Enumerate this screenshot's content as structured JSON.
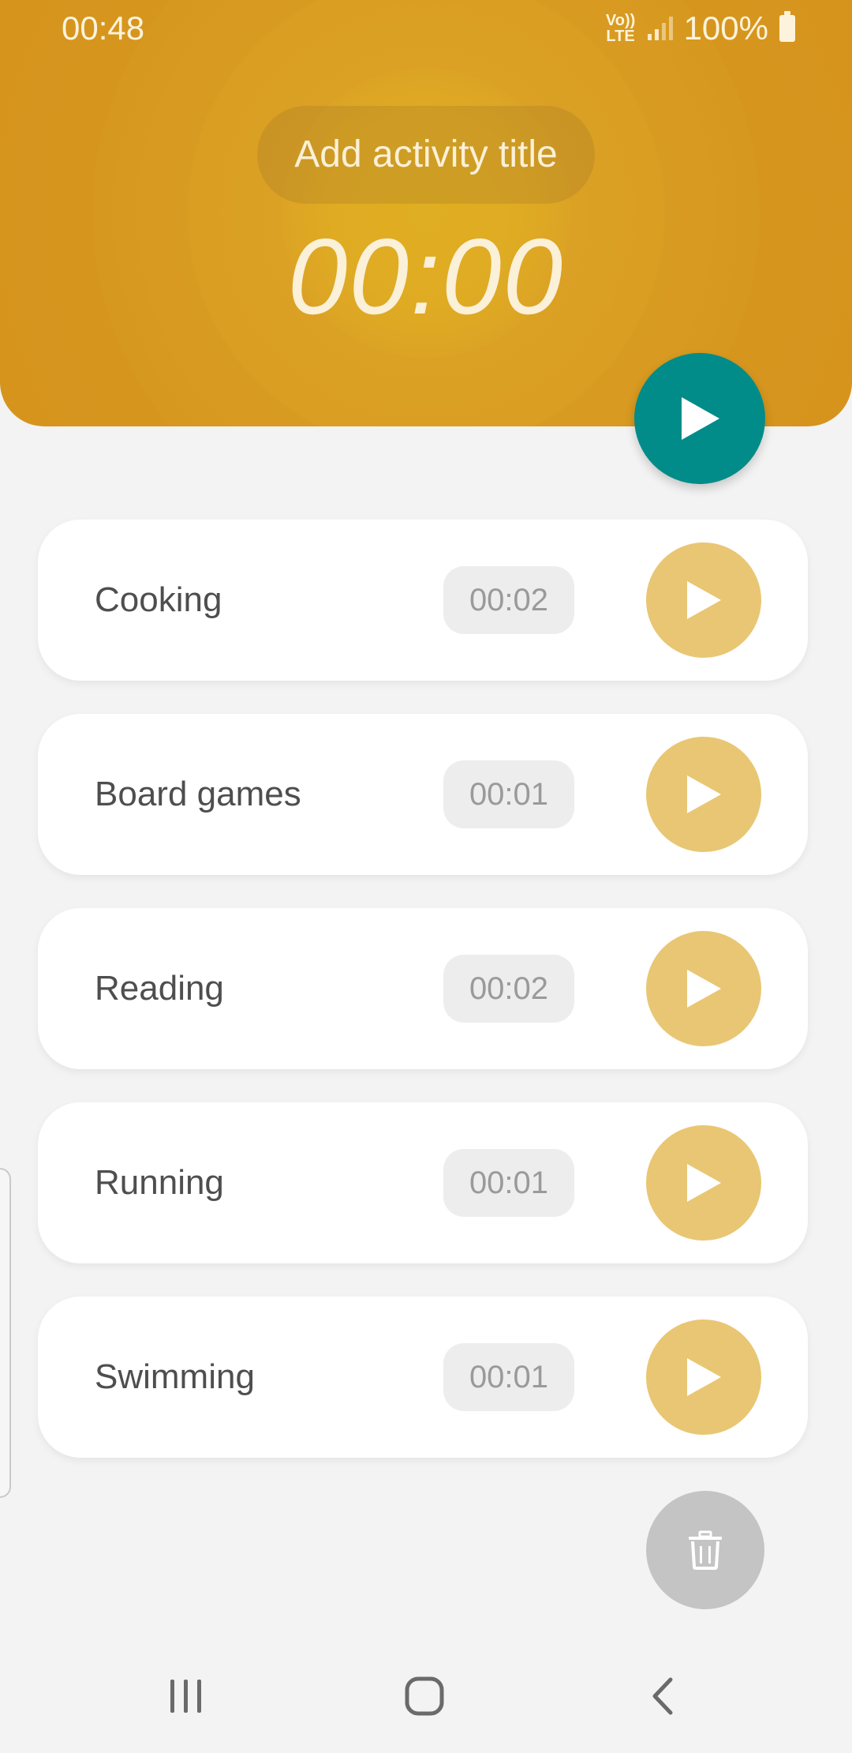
{
  "status_bar": {
    "time": "00:48",
    "volte_line1": "Vo))",
    "volte_line2": "LTE",
    "battery": "100%"
  },
  "header": {
    "title_placeholder": "Add activity title",
    "timer": "00:00",
    "color": "#d9a022",
    "play_button_color": "#018c89",
    "play_icon": "play-icon"
  },
  "activities": [
    {
      "name": "Cooking",
      "time": "00:02"
    },
    {
      "name": "Board games",
      "time": "00:01"
    },
    {
      "name": "Reading",
      "time": "00:02"
    },
    {
      "name": "Running",
      "time": "00:01"
    },
    {
      "name": "Swimming",
      "time": "00:01"
    }
  ],
  "colors": {
    "activity_play": "#e9c673",
    "delete_button": "#c4c4c4",
    "background": "#f3f3f3"
  },
  "icons": {
    "delete": "trash-icon",
    "nav_recents": "recent-apps-icon",
    "nav_home": "home-icon",
    "nav_back": "back-icon"
  }
}
